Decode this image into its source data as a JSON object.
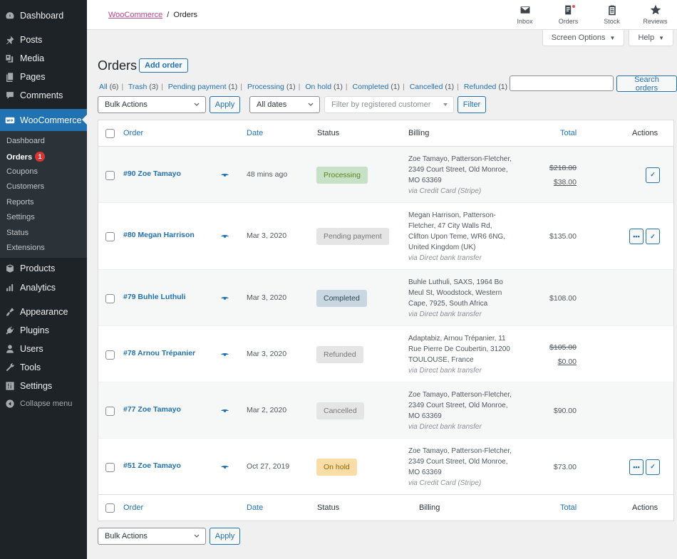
{
  "sidebar": {
    "items": [
      {
        "label": "Dashboard",
        "icon": "dashboard-icon"
      },
      {
        "label": "Posts",
        "icon": "pin-icon"
      },
      {
        "label": "Media",
        "icon": "media-icon"
      },
      {
        "label": "Pages",
        "icon": "pages-icon"
      },
      {
        "label": "Comments",
        "icon": "comment-icon"
      },
      {
        "label": "WooCommerce",
        "icon": "woo-icon"
      },
      {
        "label": "Products",
        "icon": "box-icon"
      },
      {
        "label": "Analytics",
        "icon": "bar-chart-icon"
      },
      {
        "label": "Appearance",
        "icon": "brush-icon"
      },
      {
        "label": "Plugins",
        "icon": "plug-icon"
      },
      {
        "label": "Users",
        "icon": "user-icon"
      },
      {
        "label": "Tools",
        "icon": "wrench-icon"
      },
      {
        "label": "Settings",
        "icon": "sliders-icon"
      }
    ],
    "submenu": [
      {
        "label": "Dashboard"
      },
      {
        "label": "Orders",
        "badge": "1"
      },
      {
        "label": "Coupons"
      },
      {
        "label": "Customers"
      },
      {
        "label": "Reports"
      },
      {
        "label": "Settings"
      },
      {
        "label": "Status"
      },
      {
        "label": "Extensions"
      }
    ],
    "collapse_label": "Collapse menu"
  },
  "header": {
    "breadcrumb_parent": "WooCommerce",
    "breadcrumb_separator": "/",
    "breadcrumb_current": "Orders",
    "toolbar": [
      {
        "label": "Inbox",
        "icon": "inbox-icon"
      },
      {
        "label": "Orders",
        "icon": "orders-icon"
      },
      {
        "label": "Stock",
        "icon": "clipboard-icon"
      },
      {
        "label": "Reviews",
        "icon": "star-icon"
      }
    ],
    "screen_options_label": "Screen Options",
    "help_label": "Help"
  },
  "page": {
    "title": "Orders",
    "add_order_label": "Add order",
    "filters": [
      {
        "label": "All",
        "count": "(6)"
      },
      {
        "label": "Trash",
        "count": "(3)"
      },
      {
        "label": "Pending payment",
        "count": "(1)"
      },
      {
        "label": "Processing",
        "count": "(1)"
      },
      {
        "label": "On hold",
        "count": "(1)"
      },
      {
        "label": "Completed",
        "count": "(1)"
      },
      {
        "label": "Cancelled",
        "count": "(1)"
      },
      {
        "label": "Refunded",
        "count": "(1)"
      }
    ],
    "search_value": "",
    "search_button": "Search orders",
    "bulk_actions": "Bulk Actions",
    "apply_label": "Apply",
    "dates_filter": "All dates",
    "customer_placeholder": "Filter by registered customer",
    "filter_label": "Filter"
  },
  "table": {
    "columns": {
      "order": "Order",
      "date": "Date",
      "status": "Status",
      "billing": "Billing",
      "total": "Total",
      "actions": "Actions"
    },
    "rows": [
      {
        "order": "#90 Zoe Tamayo",
        "date": "48 mins ago",
        "status": "Processing",
        "billing": [
          "Zoe Tamayo, Patterson-Fletcher,",
          "2349 Court Street, Old Monroe,",
          "MO 63369"
        ],
        "via": "via Credit Card (Stripe)",
        "total_original": "$218.00",
        "total": "$38.00",
        "actions": [
          "complete"
        ]
      },
      {
        "order": "#80 Megan Harrison",
        "date": "Mar 3, 2020",
        "status": "Pending payment",
        "billing": [
          "Megan Harrison, Patterson-",
          "Fletcher, 47 City Walls Rd,",
          "Clifton Upon Teme, WR6 6NG,",
          "United Kingdom (UK)"
        ],
        "via": "via Direct bank transfer",
        "total": "$135.00",
        "actions": [
          "processing",
          "complete"
        ]
      },
      {
        "order": "#79 Buhle Luthuli",
        "date": "Mar 3, 2020",
        "status": "Completed",
        "billing": [
          "Buhle Luthuli, SAXS, 1964 Bo",
          "Meul St, Woodstock, Western",
          "Cape, 7925, South Africa"
        ],
        "via": "via Direct bank transfer",
        "total": "$108.00",
        "actions": []
      },
      {
        "order": "#78 Arnou Trépanier",
        "date": "Mar 3, 2020",
        "status": "Refunded",
        "billing": [
          "Adaptabiz, Arnou Trépanier, 11",
          "Rue Pierre De Coubertin, 31200",
          "TOULOUSE, France"
        ],
        "via": "via Direct bank transfer",
        "total_original": "$105.00",
        "total": "$0.00",
        "actions": []
      },
      {
        "order": "#77 Zoe Tamayo",
        "date": "Mar 2, 2020",
        "status": "Cancelled",
        "billing": [
          "Zoe Tamayo, Patterson-Fletcher,",
          "2349 Court Street, Old Monroe,",
          "MO 63369"
        ],
        "via": "via Direct bank transfer",
        "total": "$90.00",
        "actions": []
      },
      {
        "order": "#51 Zoe Tamayo",
        "date": "Oct 27, 2019",
        "status": "On hold",
        "billing": [
          "Zoe Tamayo, Patterson-Fletcher,",
          "2349 Court Street, Old Monroe,",
          "MO 63369"
        ],
        "via": "via Credit Card (Stripe)",
        "total": "$73.00",
        "actions": [
          "processing",
          "complete"
        ]
      }
    ]
  },
  "status_colors": {
    "Processing": {
      "bg": "#c6e1c6",
      "fg": "#5b841b"
    },
    "Pending payment": {
      "bg": "#e5e5e5",
      "fg": "#777777"
    },
    "Completed": {
      "bg": "#c8d7e1",
      "fg": "#2e4453"
    },
    "Refunded": {
      "bg": "#e5e5e5",
      "fg": "#777777"
    },
    "Cancelled": {
      "bg": "#e5e5e5",
      "fg": "#777777"
    },
    "On hold": {
      "bg": "#f8dda7",
      "fg": "#94660c"
    }
  }
}
